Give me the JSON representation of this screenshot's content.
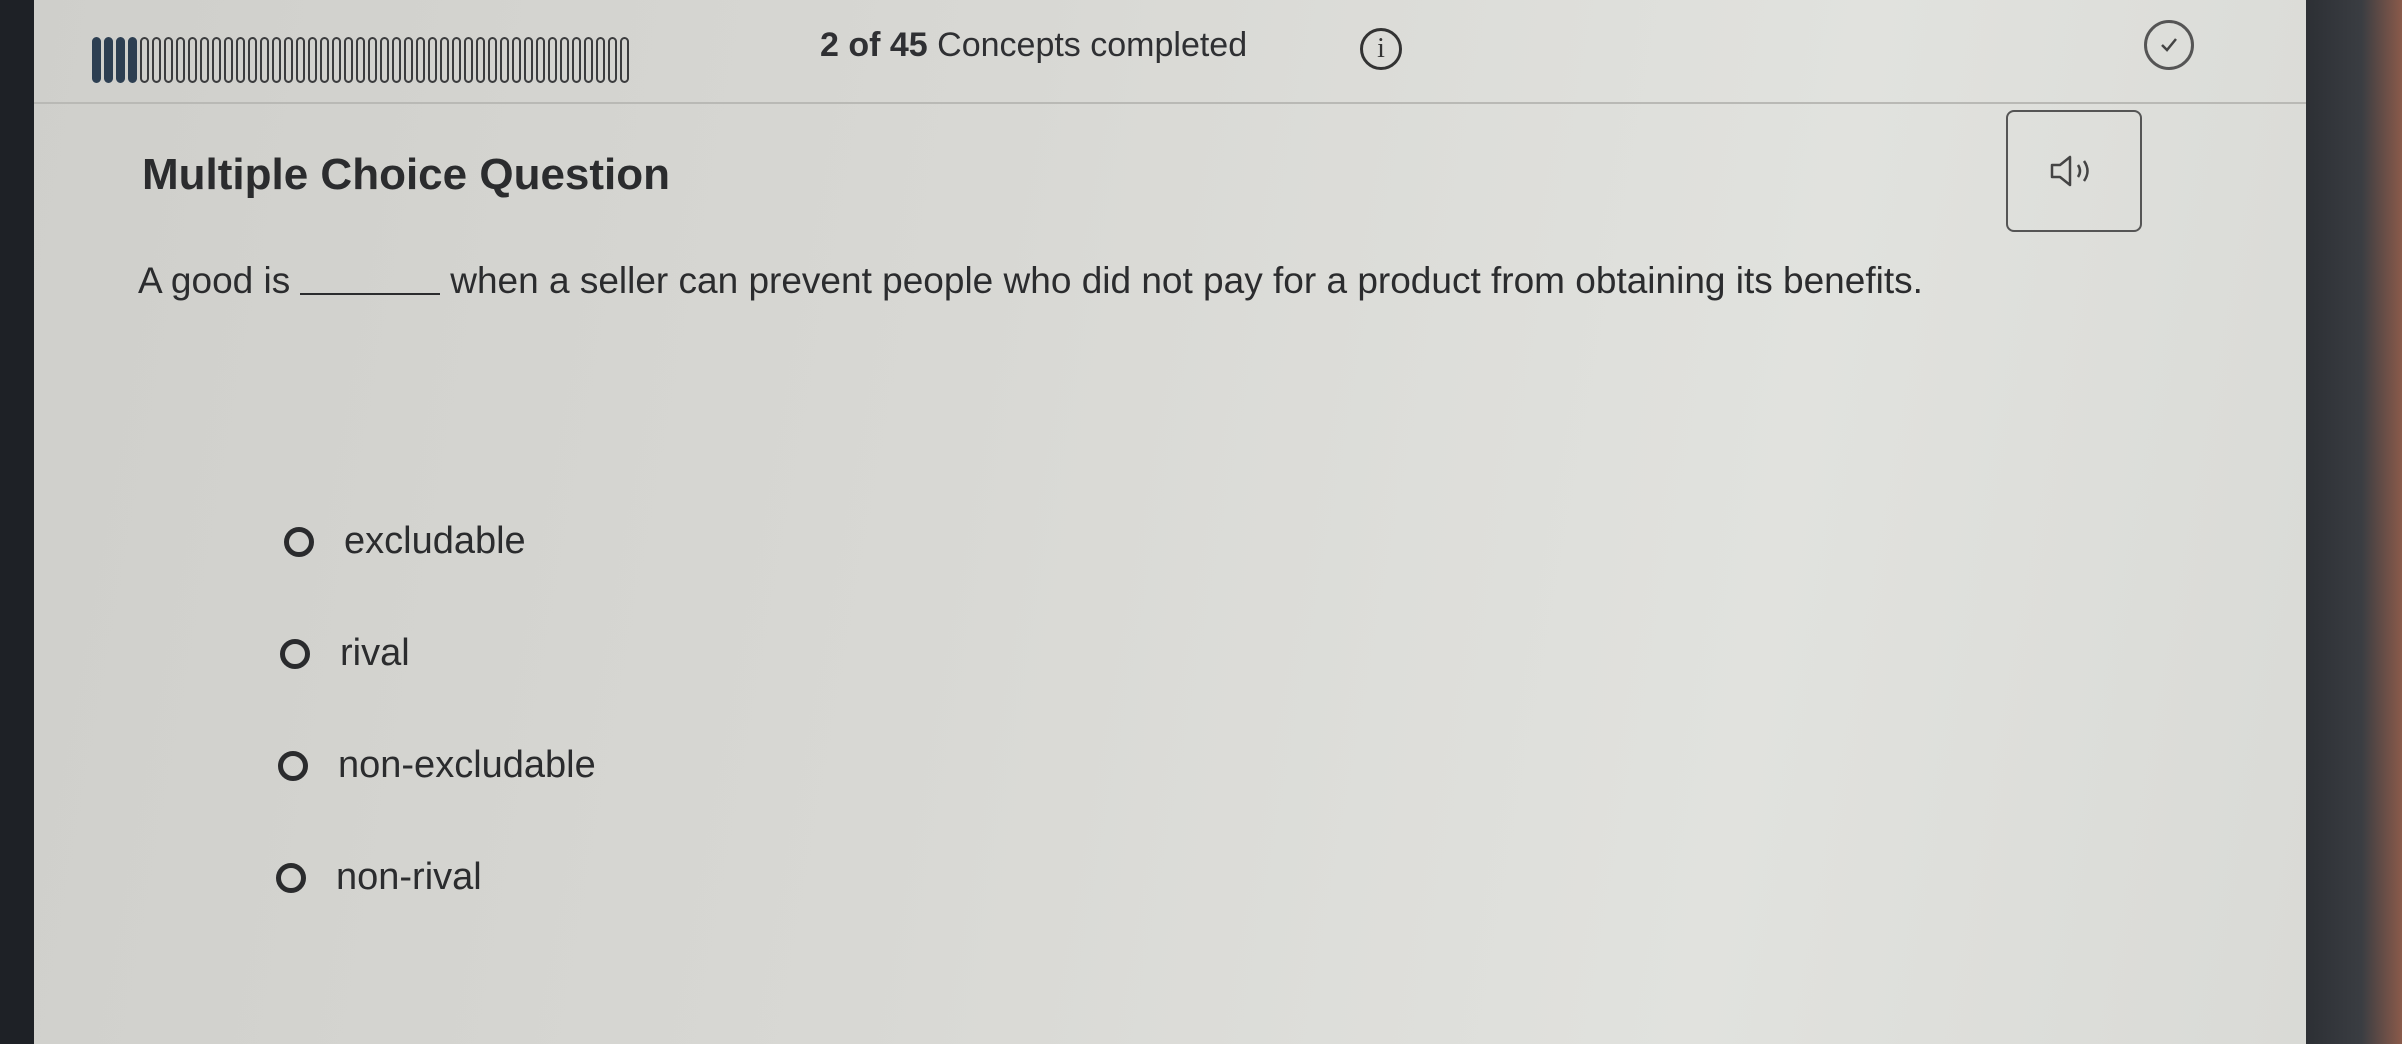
{
  "progress": {
    "completed": 2,
    "total": 45,
    "count_text": "2 of 45",
    "label": "Concepts completed",
    "segments_completed_fraction": 0.09
  },
  "icons": {
    "info": "info-icon",
    "check": "check-circle-icon",
    "audio": "speaker-icon"
  },
  "question": {
    "heading": "Multiple Choice Question",
    "text_before": "A good is",
    "text_after": "when a seller can prevent people who did not pay for a product from obtaining its benefits."
  },
  "options": [
    {
      "label": "excludable",
      "selected": false
    },
    {
      "label": "rival",
      "selected": false
    },
    {
      "label": "non-excludable",
      "selected": false
    },
    {
      "label": "non-rival",
      "selected": false
    }
  ],
  "colors": {
    "segment_done": "#2d3f52",
    "text": "#2b2c2e"
  }
}
